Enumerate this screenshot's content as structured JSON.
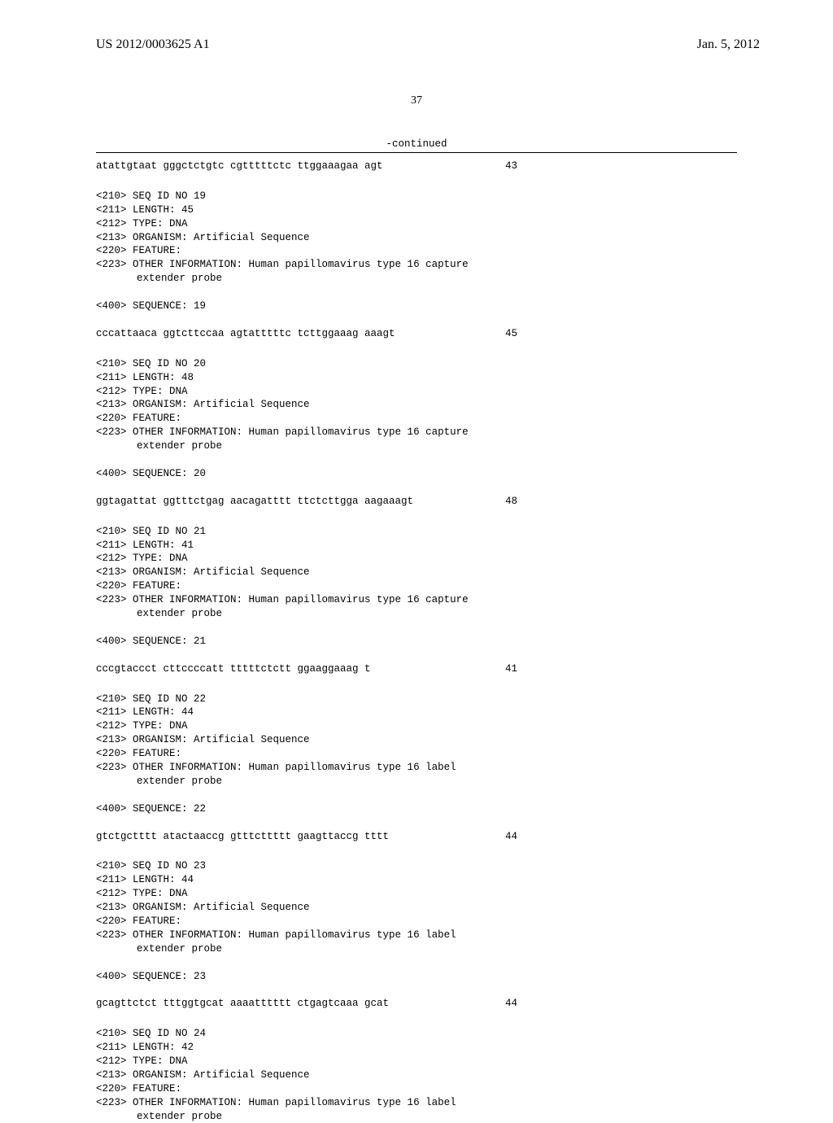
{
  "header": {
    "pub_number": "US 2012/0003625 A1",
    "pub_date": "Jan. 5, 2012"
  },
  "page_number": "37",
  "continued_label": "-continued",
  "entries": [
    {
      "sequence": "atattgtaat gggctctgtc cgtttttctc ttggaaagaa agt",
      "length_num": "43",
      "has_header": false
    },
    {
      "seq_id": "<210> SEQ ID NO 19",
      "length": "<211> LENGTH: 45",
      "type": "<212> TYPE: DNA",
      "organism": "<213> ORGANISM: Artificial Sequence",
      "feature": "<220> FEATURE:",
      "other_info": "<223> OTHER INFORMATION: Human papillomavirus type 16 capture",
      "other_info_2": "extender probe",
      "sequence_header": "<400> SEQUENCE: 19",
      "sequence": "cccattaaca ggtcttccaa agtatttttc tcttggaaag aaagt",
      "length_num": "45",
      "has_header": true
    },
    {
      "seq_id": "<210> SEQ ID NO 20",
      "length": "<211> LENGTH: 48",
      "type": "<212> TYPE: DNA",
      "organism": "<213> ORGANISM: Artificial Sequence",
      "feature": "<220> FEATURE:",
      "other_info": "<223> OTHER INFORMATION: Human papillomavirus type 16 capture",
      "other_info_2": "extender probe",
      "sequence_header": "<400> SEQUENCE: 20",
      "sequence": "ggtagattat ggtttctgag aacagatttt ttctcttgga aagaaagt",
      "length_num": "48",
      "has_header": true
    },
    {
      "seq_id": "<210> SEQ ID NO 21",
      "length": "<211> LENGTH: 41",
      "type": "<212> TYPE: DNA",
      "organism": "<213> ORGANISM: Artificial Sequence",
      "feature": "<220> FEATURE:",
      "other_info": "<223> OTHER INFORMATION: Human papillomavirus type 16 capture",
      "other_info_2": "extender probe",
      "sequence_header": "<400> SEQUENCE: 21",
      "sequence": "cccgtaccct cttccccatt tttttctctt ggaaggaaag t",
      "length_num": "41",
      "has_header": true
    },
    {
      "seq_id": "<210> SEQ ID NO 22",
      "length": "<211> LENGTH: 44",
      "type": "<212> TYPE: DNA",
      "organism": "<213> ORGANISM: Artificial Sequence",
      "feature": "<220> FEATURE:",
      "other_info": "<223> OTHER INFORMATION: Human papillomavirus type 16 label",
      "other_info_2": "extender probe",
      "sequence_header": "<400> SEQUENCE: 22",
      "sequence": "gtctgctttt atactaaccg gtttcttttt gaagttaccg tttt",
      "length_num": "44",
      "has_header": true
    },
    {
      "seq_id": "<210> SEQ ID NO 23",
      "length": "<211> LENGTH: 44",
      "type": "<212> TYPE: DNA",
      "organism": "<213> ORGANISM: Artificial Sequence",
      "feature": "<220> FEATURE:",
      "other_info": "<223> OTHER INFORMATION: Human papillomavirus type 16 label",
      "other_info_2": "extender probe",
      "sequence_header": "<400> SEQUENCE: 23",
      "sequence": "gcagttctct tttggtgcat aaaatttttt ctgagtcaaa gcat",
      "length_num": "44",
      "has_header": true
    },
    {
      "seq_id": "<210> SEQ ID NO 24",
      "length": "<211> LENGTH: 42",
      "type": "<212> TYPE: DNA",
      "organism": "<213> ORGANISM: Artificial Sequence",
      "feature": "<220> FEATURE:",
      "other_info": "<223> OTHER INFORMATION: Human papillomavirus type 16 label",
      "other_info_2": "extender probe",
      "has_header": true,
      "no_sequence": true
    }
  ]
}
